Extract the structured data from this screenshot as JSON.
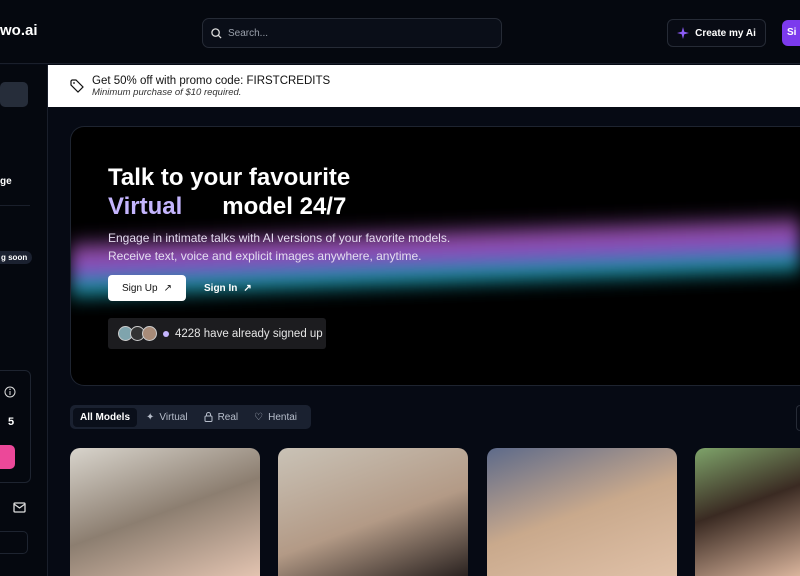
{
  "header": {
    "logo": "wo.ai",
    "search_placeholder": "Search...",
    "create_label": "Create my Ai",
    "signup_label": "Si",
    "accent": "#7c3aed"
  },
  "sidebar": {
    "text_fragment": "ge",
    "badge": "g soon",
    "count": "5",
    "pink": "#ec4899"
  },
  "promo": {
    "title": "Get 50% off with promo code: FIRSTCREDITS",
    "subtitle": "Minimum purchase of $10 required."
  },
  "hero": {
    "title_line1": "Talk to your favourite",
    "title_highlight": "Virtual",
    "title_line2": "model 24/7",
    "subtitle1": "Engage in intimate talks with AI versions of your favorite models.",
    "subtitle2": "Receive text, voice and explicit images anywhere, anytime.",
    "sign_up": "Sign Up",
    "sign_in": "Sign In",
    "signed_up": "4228 have already signed up"
  },
  "filters": [
    {
      "label": "All Models",
      "icon": "grid"
    },
    {
      "label": "Virtual",
      "icon": "sparkles-icon"
    },
    {
      "label": "Real",
      "icon": "lock-icon"
    },
    {
      "label": "Hentai",
      "icon": "heart-icon"
    }
  ]
}
